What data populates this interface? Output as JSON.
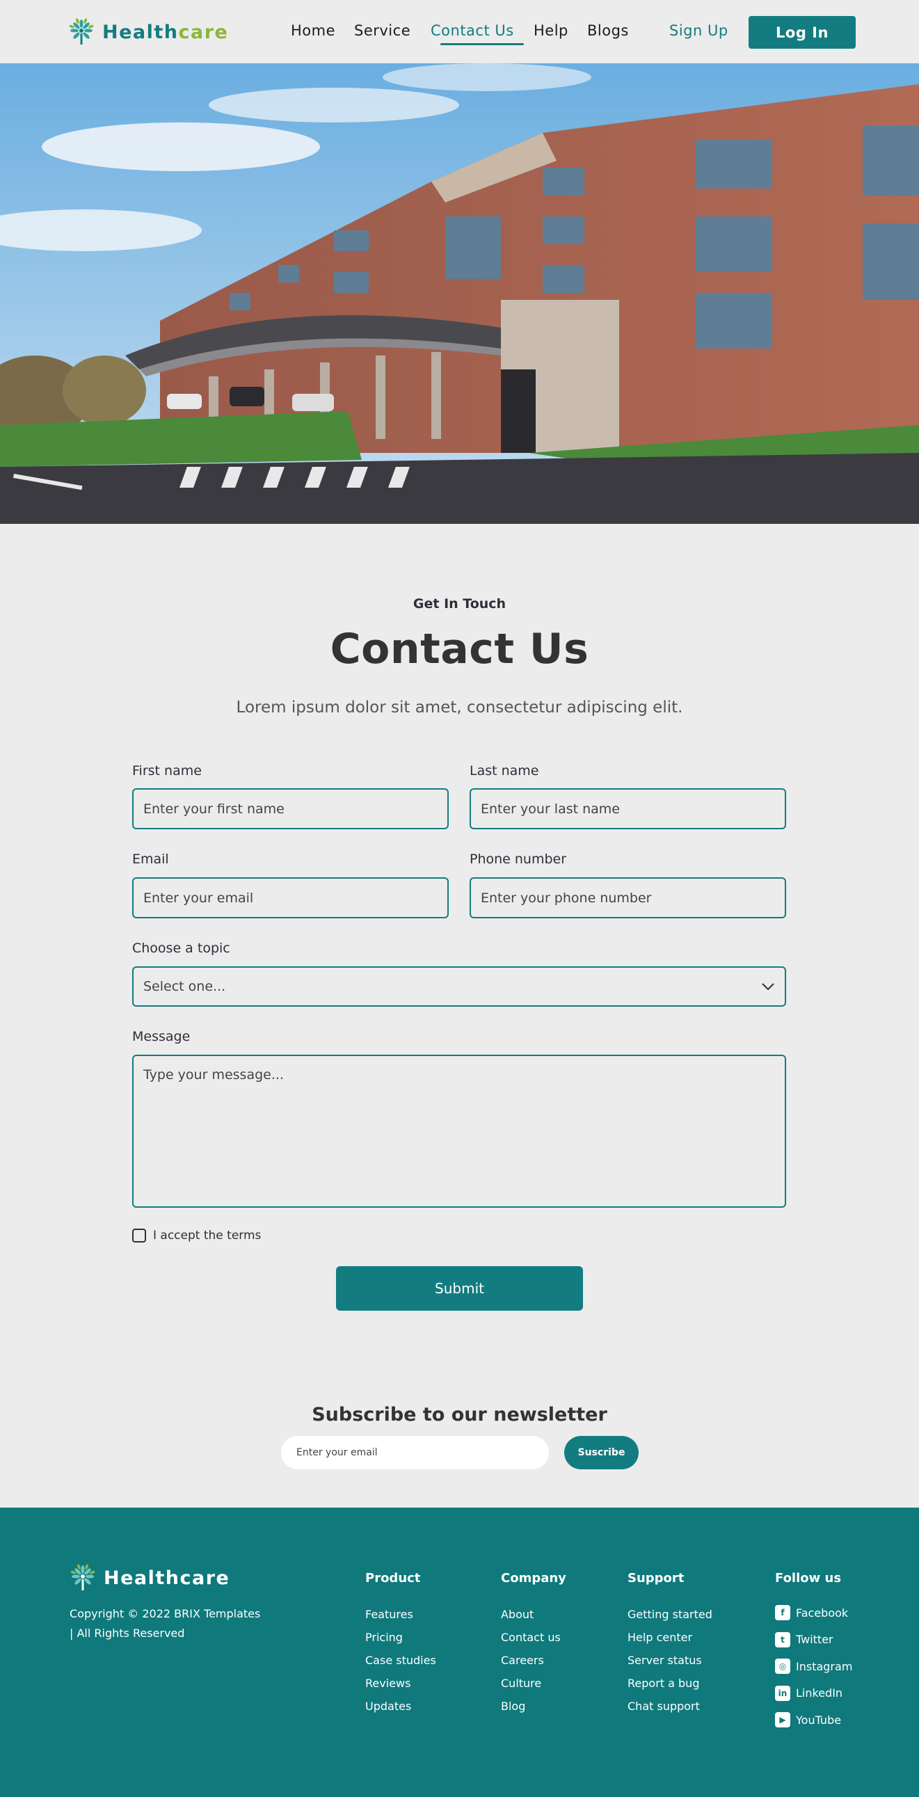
{
  "brand": {
    "name_part1": "Health",
    "name_part2": "care",
    "primary_color": "#137c80",
    "accent_color": "#8cb63c"
  },
  "nav": {
    "links": [
      {
        "label": "Home"
      },
      {
        "label": "Service"
      },
      {
        "label": "Contact Us",
        "active": true
      },
      {
        "label": "Help"
      },
      {
        "label": "Blogs"
      }
    ],
    "signup_label": "Sign Up",
    "login_label": "Log In"
  },
  "hero": {
    "image": "hospital-building-photo"
  },
  "contact": {
    "eyebrow": "Get In Touch",
    "title": "Contact Us",
    "subtitle": "Lorem ipsum dolor sit amet, consectetur adipiscing elit.",
    "first_name": {
      "label": "First name",
      "placeholder": "Enter your first name"
    },
    "last_name": {
      "label": "Last name",
      "placeholder": "Enter your last name"
    },
    "email": {
      "label": "Email",
      "placeholder": "Enter your email"
    },
    "phone": {
      "label": "Phone number",
      "placeholder": "Enter your phone number"
    },
    "topic": {
      "label": "Choose a topic",
      "selected": "Select one..."
    },
    "message": {
      "label": "Message",
      "placeholder": "Type your message..."
    },
    "terms_label": "I accept the terms",
    "submit_label": "Submit"
  },
  "newsletter": {
    "title": "Subscribe to our newsletter",
    "placeholder": "Enter your email",
    "button_label": "Suscribe"
  },
  "footer": {
    "copyright_line1": "Copyright © 2022 BRIX Templates",
    "copyright_line2": "| All Rights Reserved",
    "columns": [
      {
        "heading": "Product",
        "items": [
          "Features",
          "Pricing",
          "Case studies",
          "Reviews",
          "Updates"
        ]
      },
      {
        "heading": "Company",
        "items": [
          "About",
          "Contact us",
          "Careers",
          "Culture",
          "Blog"
        ]
      },
      {
        "heading": "Support",
        "items": [
          "Getting started",
          "Help center",
          "Server status",
          "Report a bug",
          "Chat support"
        ]
      }
    ],
    "follow": {
      "heading": "Follow us",
      "items": [
        {
          "label": "Facebook",
          "icon": "facebook-icon"
        },
        {
          "label": "Twitter",
          "icon": "twitter-icon"
        },
        {
          "label": "Instagram",
          "icon": "instagram-icon"
        },
        {
          "label": "LinkedIn",
          "icon": "linkedin-icon"
        },
        {
          "label": "YouTube",
          "icon": "youtube-icon"
        }
      ]
    }
  }
}
